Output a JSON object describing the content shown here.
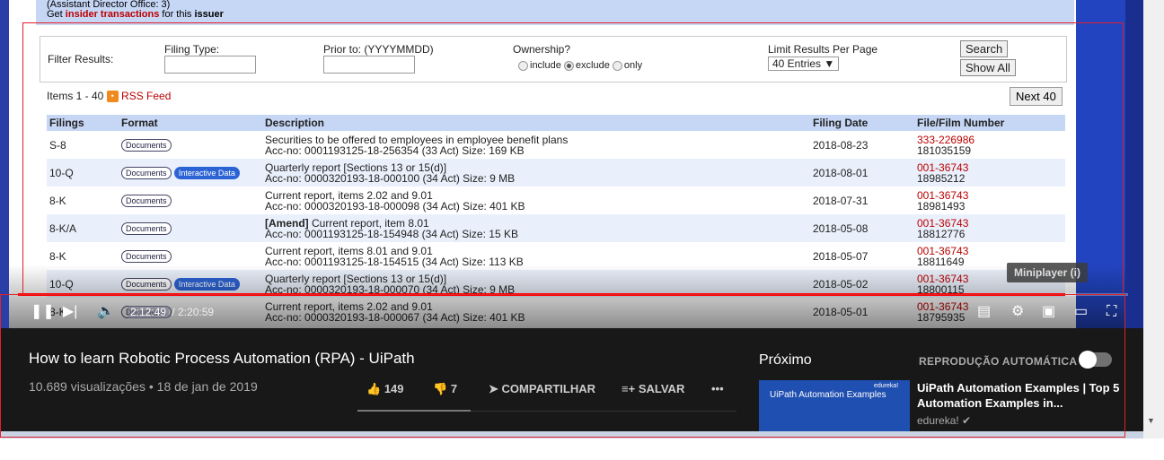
{
  "edgar": {
    "top_line1": "(Assistant Director Office: 3)",
    "top_line2_pre": "Get ",
    "top_line2_link": "insider transactions",
    "top_line2_mid": " for this ",
    "top_line2_bold": "issuer",
    "filter": {
      "label": "Filter Results:",
      "filing_type_label": "Filing Type:",
      "prior_to_label": "Prior to: (YYYYMMDD)",
      "ownership_label": "Ownership?",
      "ownership_include": "include",
      "ownership_exclude": "exclude",
      "ownership_only": "only",
      "limit_label": "Limit Results Per Page",
      "limit_value": "40 Entries",
      "search_button": "Search",
      "show_all_button": "Show All"
    },
    "items_text": "Items 1 - 40",
    "rss_label": "RSS Feed",
    "next_button": "Next 40",
    "columns": [
      "Filings",
      "Format",
      "Description",
      "Filing Date",
      "File/Film Number"
    ],
    "rows": [
      {
        "filing": "S-8",
        "interactive": false,
        "desc1_bold": "",
        "desc1": "Securities to be offered to employees in employee benefit plans",
        "desc2": "Acc-no: 0001193125-18-256354 (33 Act)  Size: 169 KB",
        "date": "2018-08-23",
        "file_no": "333-226986",
        "film_no": "181035159"
      },
      {
        "filing": "10-Q",
        "interactive": true,
        "desc1_bold": "",
        "desc1": "Quarterly report [Sections 13 or 15(d)]",
        "desc2": "Acc-no: 0000320193-18-000100 (34 Act)  Size: 9 MB",
        "date": "2018-08-01",
        "file_no": "001-36743",
        "film_no": "18985212"
      },
      {
        "filing": "8-K",
        "interactive": false,
        "desc1_bold": "",
        "desc1": "Current report, items 2.02 and 9.01",
        "desc2": "Acc-no: 0000320193-18-000098 (34 Act)  Size: 401 KB",
        "date": "2018-07-31",
        "file_no": "001-36743",
        "film_no": "18981493"
      },
      {
        "filing": "8-K/A",
        "interactive": false,
        "desc1_bold": "[Amend]",
        "desc1": " Current report, item 8.01",
        "desc2": "Acc-no: 0001193125-18-154948 (34 Act)  Size: 15 KB",
        "date": "2018-05-08",
        "file_no": "001-36743",
        "film_no": "18812776"
      },
      {
        "filing": "8-K",
        "interactive": false,
        "desc1_bold": "",
        "desc1": "Current report, items 8.01 and 9.01",
        "desc2": "Acc-no: 0001193125-18-154515 (34 Act)  Size: 113 KB",
        "date": "2018-05-07",
        "file_no": "001-36743",
        "film_no": "18811649"
      },
      {
        "filing": "10-Q",
        "interactive": true,
        "desc1_bold": "",
        "desc1": "Quarterly report [Sections 13 or 15(d)]",
        "desc2": "Acc-no: 0000320193-18-000070 (34 Act)  Size: 9 MB",
        "date": "2018-05-02",
        "file_no": "001-36743",
        "film_no": "18800115"
      },
      {
        "filing": "8-K",
        "interactive": false,
        "desc1_bold": "",
        "desc1": "Current report, items 2.02 and 9.01",
        "desc2": "Acc-no: 0000320193-18-000067 (34 Act)  Size: 401 KB",
        "date": "2018-05-01",
        "file_no": "001-36743",
        "film_no": "18795935"
      }
    ],
    "documents_pill": "Documents",
    "interactive_pill": "Interactive Data"
  },
  "player": {
    "current_time": "2:12:49",
    "duration": "/ 2:20:59",
    "progress_fraction": 0.943,
    "miniplayer_label": "Miniplayer (i)"
  },
  "video": {
    "title": "How to learn Robotic Process Automation (RPA) - UiPath",
    "meta": "10.689 visualizações • 18 de jan de 2019",
    "likes": "149",
    "dislikes": "7",
    "share": "COMPARTILHAR",
    "save": "SALVAR"
  },
  "sidebar": {
    "next_label": "Próximo",
    "autoplay_label": "REPRODUÇÃO AUTOMÁTICA",
    "thumb_title": "UiPath Automation Examples",
    "thumb_brand": "edureka!",
    "next_title": "UiPath Automation Examples | Top 5 Automation Examples in...",
    "next_channel": "edureka!"
  },
  "colors": {
    "accent_red": "#e0202a",
    "youtube_dark": "#181818",
    "edgar_header": "#c6d6f5",
    "file_link": "#bb0000"
  }
}
